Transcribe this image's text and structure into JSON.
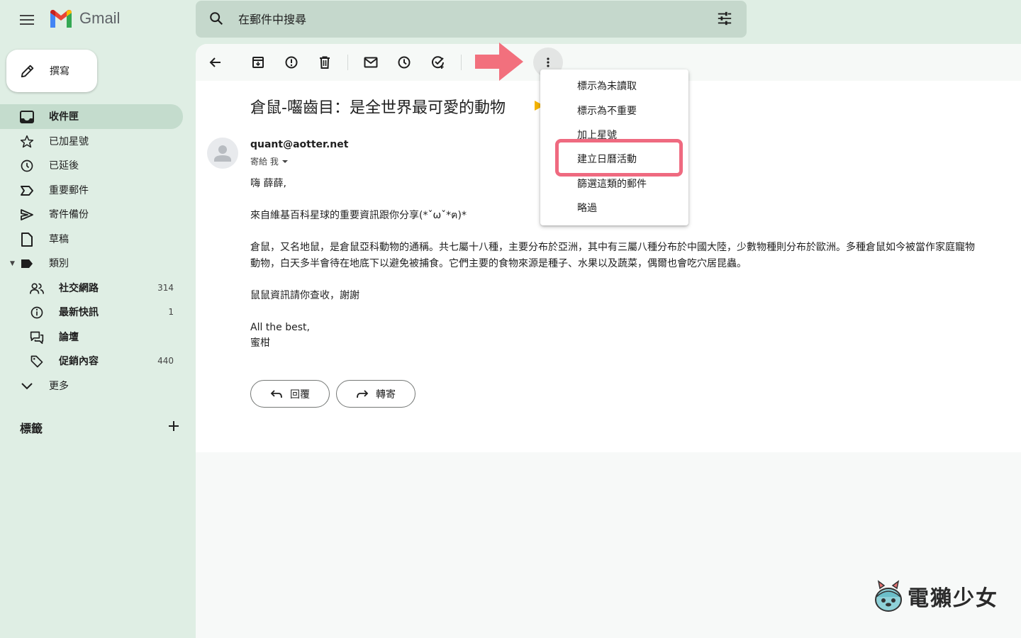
{
  "header": {
    "app_name": "Gmail",
    "search_placeholder": "在郵件中搜尋"
  },
  "sidebar": {
    "compose_label": "撰寫",
    "items": [
      {
        "label": "收件匣",
        "icon": "inbox-icon",
        "active": true
      },
      {
        "label": "已加星號",
        "icon": "star-icon"
      },
      {
        "label": "已延後",
        "icon": "clock-icon"
      },
      {
        "label": "重要郵件",
        "icon": "important-icon"
      },
      {
        "label": "寄件備份",
        "icon": "send-icon"
      },
      {
        "label": "草稿",
        "icon": "draft-icon"
      },
      {
        "label": "類別",
        "icon": "label-icon"
      },
      {
        "label": "社交網路",
        "icon": "people-icon",
        "count": "314"
      },
      {
        "label": "最新快訊",
        "icon": "info-icon",
        "count": "1"
      },
      {
        "label": "論壇",
        "icon": "forum-icon"
      },
      {
        "label": "促銷內容",
        "icon": "tag-icon",
        "count": "440"
      },
      {
        "label": "更多",
        "icon": "expand-icon"
      }
    ],
    "labels_title": "標籤"
  },
  "email": {
    "subject": "倉鼠-囓齒目：是全世界最可愛的動物",
    "sender": "quant@aotter.net",
    "to": "寄給 我",
    "body": [
      "嗨 薛薛,",
      "",
      "來自維基百科星球的重要資訊跟你分享(*ˇωˇ*ฅ)*",
      "",
      "倉鼠，又名地鼠，是倉鼠亞科動物的通稱。共七屬十八種，主要分布於亞洲，其中有三屬八種分布於中國大陸，少數物種則分布於歐洲。多種倉鼠如今被當作家庭寵物",
      "動物，白天多半會待在地底下以避免被捕食。它們主要的食物來源是種子、水果以及蔬菜，偶爾也會吃穴居昆蟲。",
      "",
      "鼠鼠資訊請你查收，謝謝",
      "",
      "All the best,",
      "蜜柑"
    ],
    "reply_label": "回覆",
    "forward_label": "轉寄"
  },
  "menu": {
    "items": [
      "標示為未讀取",
      "標示為不重要",
      "加上星號",
      "建立日曆活動",
      "篩選這類的郵件",
      "略過"
    ],
    "highlighted_index": 3,
    "highlight_color": "#ef6a80"
  },
  "watermark": {
    "text": "電獺少女"
  },
  "colors": {
    "background": "#dfeee4",
    "search_bg": "#c5d8cc",
    "active_nav": "#c4dccd",
    "arrow": "#f2707d"
  }
}
